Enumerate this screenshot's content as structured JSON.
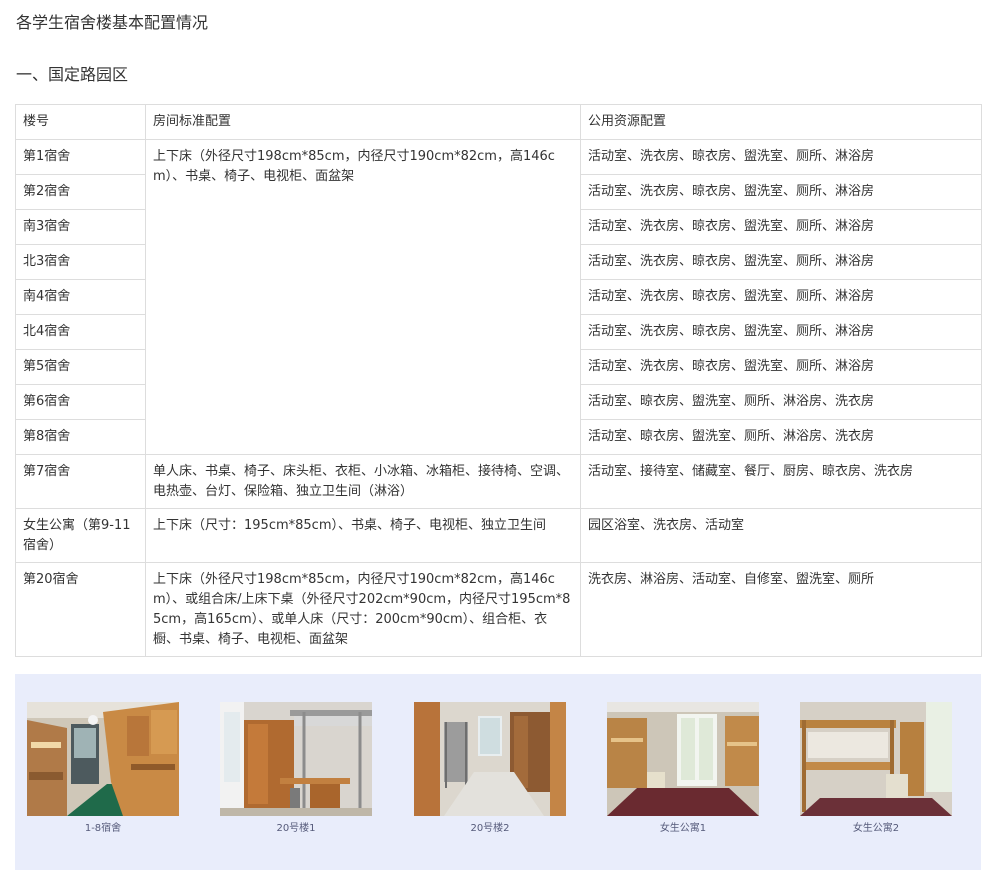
{
  "page": {
    "title": "各学生宿舍楼基本配置情况",
    "section_title": "一、国定路园区"
  },
  "table": {
    "headers": [
      "楼号",
      "房间标准配置",
      "公用资源配置"
    ],
    "shared_config_1_8": "上下床（外径尺寸198cm*85cm，内径尺寸190cm*82cm，高146cm）、书桌、椅子、电视柜、面盆架",
    "rows": [
      {
        "building": "第1宿舍",
        "public": "活动室、洗衣房、晾衣房、盥洗室、厕所、淋浴房"
      },
      {
        "building": "第2宿舍",
        "public": "活动室、洗衣房、晾衣房、盥洗室、厕所、淋浴房"
      },
      {
        "building": "南3宿舍",
        "public": "活动室、洗衣房、晾衣房、盥洗室、厕所、淋浴房"
      },
      {
        "building": "北3宿舍",
        "public": "活动室、洗衣房、晾衣房、盥洗室、厕所、淋浴房"
      },
      {
        "building": "南4宿舍",
        "public": "活动室、洗衣房、晾衣房、盥洗室、厕所、淋浴房"
      },
      {
        "building": "北4宿舍",
        "public": "活动室、洗衣房、晾衣房、盥洗室、厕所、淋浴房"
      },
      {
        "building": "第5宿舍",
        "public": "活动室、洗衣房、晾衣房、盥洗室、厕所、淋浴房"
      },
      {
        "building": "第6宿舍",
        "public": "活动室、晾衣房、盥洗室、厕所、淋浴房、洗衣房"
      },
      {
        "building": "第8宿舍",
        "public": "活动室、晾衣房、盥洗室、厕所、淋浴房、洗衣房"
      },
      {
        "building": "第7宿舍",
        "room": "单人床、书桌、椅子、床头柜、衣柜、小冰箱、冰箱柜、接待椅、空调、电热壶、台灯、保险箱、独立卫生间（淋浴）",
        "public": "活动室、接待室、储藏室、餐厅、厨房、晾衣房、洗衣房"
      },
      {
        "building": "女生公寓（第9-11宿舍）",
        "room": "上下床（尺寸：195cm*85cm）、书桌、椅子、电视柜、独立卫生间",
        "public": "园区浴室、洗衣房、活动室"
      },
      {
        "building": "第20宿舍",
        "room": "上下床（外径尺寸198cm*85cm，内径尺寸190cm*82cm，高146cm）、或组合床/上床下桌（外径尺寸202cm*90cm，内径尺寸195cm*85cm，高165cm）、或单人床（尺寸：200cm*90cm）、组合柜、衣橱、书桌、椅子、电视柜、面盆架",
        "public": "洗衣房、淋浴房、活动室、自修室、盥洗室、厕所"
      }
    ]
  },
  "gallery": {
    "photos": [
      {
        "caption": "1-8宿舍",
        "icon": "dorm-room-photo"
      },
      {
        "caption": "20号楼1",
        "icon": "dorm-room-photo"
      },
      {
        "caption": "20号楼2",
        "icon": "dorm-room-photo"
      },
      {
        "caption": "女生公寓1",
        "icon": "dorm-room-photo"
      },
      {
        "caption": "女生公寓2",
        "icon": "dorm-room-photo"
      }
    ]
  }
}
